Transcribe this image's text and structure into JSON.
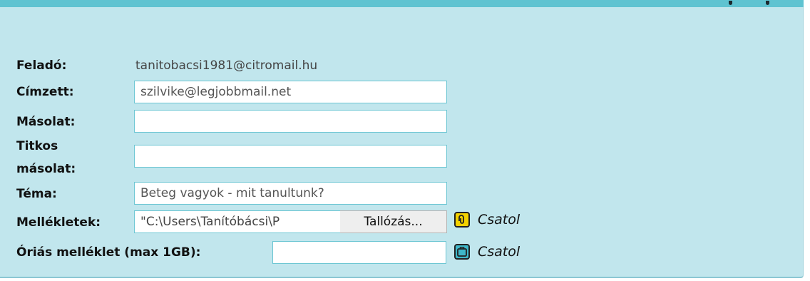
{
  "form": {
    "sender": {
      "label": "Feladó:",
      "value": "tanitobacsi1981@citromail.hu"
    },
    "to": {
      "label": "Címzett:",
      "value": "szilvike@legjobbmail.net"
    },
    "cc": {
      "label": "Másolat:",
      "value": ""
    },
    "bcc": {
      "label_line1": "Titkos",
      "label_line2": "másolat:",
      "value": ""
    },
    "subject": {
      "label": "Téma:",
      "value": "Beteg vagyok - mit tanultunk?"
    },
    "attachments": {
      "label": "Mellékletek:",
      "file_path": "\"C:\\Users\\Tanítóbácsi\\P",
      "browse_label": "Tallózás...",
      "attach_label": "Csatol",
      "icon": "paperclip-icon"
    },
    "giant_attachment": {
      "label": "Óriás melléklet (max 1GB):",
      "value": "",
      "attach_label": "Csatol",
      "icon": "briefcase-icon"
    }
  },
  "colors": {
    "panel_bg": "#c1e6ed",
    "top_bar": "#5fc3d1",
    "field_border": "#6cc6d3",
    "clip_icon": "#f2d200",
    "box_icon": "#3fb7c9"
  }
}
